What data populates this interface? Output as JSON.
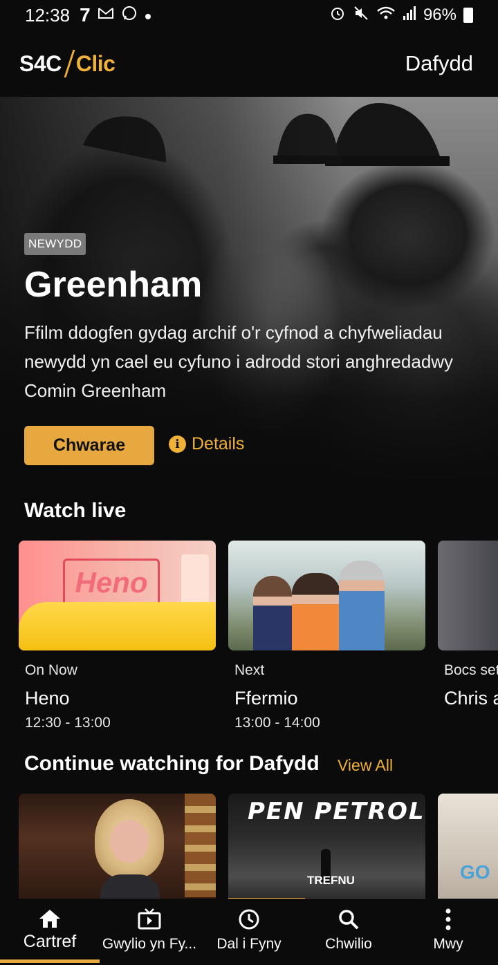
{
  "status_bar": {
    "time": "12:38",
    "left_icons": [
      "seven-icon",
      "gmail-icon",
      "whatsapp-icon",
      "dot-icon"
    ],
    "right_icons": [
      "alarm-icon",
      "mute-icon",
      "wifi-icon",
      "signal-icon"
    ],
    "battery": "96%"
  },
  "header": {
    "logo_left": "S4C",
    "logo_right": "Clic",
    "user": "Dafydd"
  },
  "hero": {
    "badge": "NEWYDD",
    "title": "Greenham",
    "description": "Ffilm ddogfen gydag archif o'r cyfnod a chyfweliadau newydd yn cael eu cyfuno i adrodd stori anghredadwy Comin Greenham",
    "play_label": "Chwarae",
    "details_label": "Details",
    "info_glyph": "i"
  },
  "watch_live": {
    "title": "Watch live",
    "items": [
      {
        "label": "On Now",
        "title": "Heno",
        "time": "12:30 - 13:00",
        "sign_text": "Heno"
      },
      {
        "label": "Next",
        "title": "Ffermio",
        "time": "13:00 - 14:00"
      },
      {
        "label": "Bocs set",
        "title": "Chris a",
        "time": ""
      }
    ]
  },
  "continue_watching": {
    "title": "Continue watching for Dafydd",
    "view_all": "View All",
    "items": [
      {
        "progress": 0
      },
      {
        "title_art": "PEN PETROL",
        "sub_art": "TREFNU",
        "progress": 0.39
      },
      {
        "art_text": "GO",
        "progress": 0
      }
    ]
  },
  "bottom_nav": {
    "items": [
      {
        "label": "Cartref",
        "icon": "home-icon",
        "active": true
      },
      {
        "label": "Gwylio yn Fy...",
        "icon": "tv-icon",
        "active": false
      },
      {
        "label": "Dal i Fyny",
        "icon": "clock-icon",
        "active": false
      },
      {
        "label": "Chwilio",
        "icon": "search-icon",
        "active": false
      },
      {
        "label": "Mwy",
        "icon": "more-icon",
        "active": false
      }
    ]
  },
  "colors": {
    "accent": "#f0b138",
    "button": "#e7a840",
    "background": "#0b0b0b"
  }
}
